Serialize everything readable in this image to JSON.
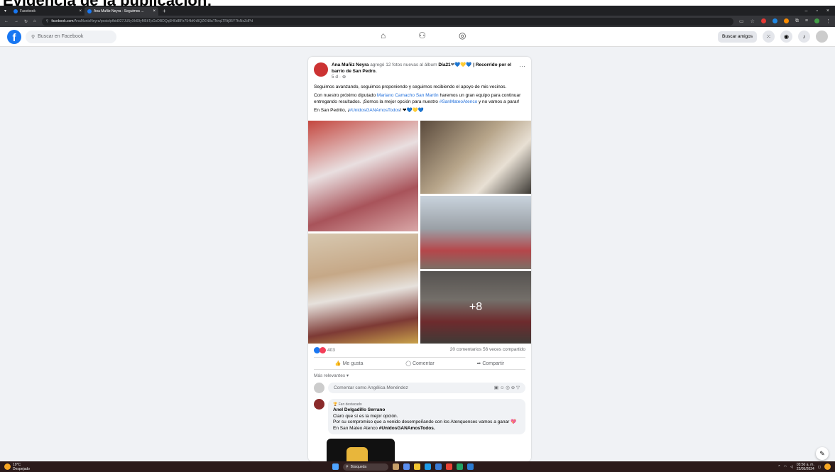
{
  "heading": "Evidencia de la publicación:",
  "browser": {
    "tabs": [
      {
        "label": "Facebook",
        "active": false
      },
      {
        "label": "Ana Muñiz Neyra - Seguimos ...",
        "active": true
      }
    ],
    "url_domain": "facebook.com",
    "url_path": "/AnaMunizNeyra/posts/pfbid027JU5yXk69yM5kTpGxDBDQq5H6dBPz754bKhBQZKN8aTNrqLTRtj95Y7fcNxZdPd"
  },
  "facebook": {
    "search_placeholder": "Buscar en Facebook",
    "find_friends_label": "Buscar amigos"
  },
  "post": {
    "author": "Ana Muñiz Neyra",
    "action": "agregó 12 fotos nuevas al álbum",
    "album": "Día21",
    "album_suffix": "| Recorrido por el barrio de San Pedro.",
    "time": "5 d · ",
    "para1": "Seguimos avanzando, seguimos proponiendo y seguimos recibiendo el apoyo de mis vecinos.",
    "para2_start": "Con nuestro próximo diputado",
    "para2_link": "Mariano Camacho San Martín",
    "para2_mid": "haremos un gran equipo para continuar entregando resultados. ¡Somos la mejor opción para nuestro",
    "para2_hashtag": "#SanMateoAtenco",
    "para2_end": "y no vamos a parar!",
    "para3_start": "En San Pedrito, ¡",
    "para3_hashtag": "#UnidosGANAmosTodos",
    "para3_end": "!",
    "more_photos": "+8",
    "reactions_count": "403",
    "comments_shares": "20 comentarios  56 veces compartido",
    "like_label": "Me gusta",
    "comment_label": "Comentar",
    "share_label": "Compartir",
    "sort_label": "Más relevantes ▾",
    "comment_placeholder": "Comentar como Angélica Menéndez"
  },
  "comment": {
    "badge": "Fan destacado",
    "author": "Anel Delgadillo Serrano",
    "line1": "Claro que sí es la mejor opción.",
    "line2": "Por su compromiso que a venido desempeñando con los Atenquenses vamos a ganar",
    "line3_start": "En San Mateo Atenco",
    "line3_hashtag": "#UnidosGANAmosTodos."
  },
  "taskbar": {
    "temp": "19°C",
    "weather": "Despejado",
    "search": "Búsqueda",
    "time": "03:50 a. m.",
    "date": "22/05/2024"
  },
  "colors": {
    "brand": "#1877f2",
    "link": "#216fdb"
  }
}
